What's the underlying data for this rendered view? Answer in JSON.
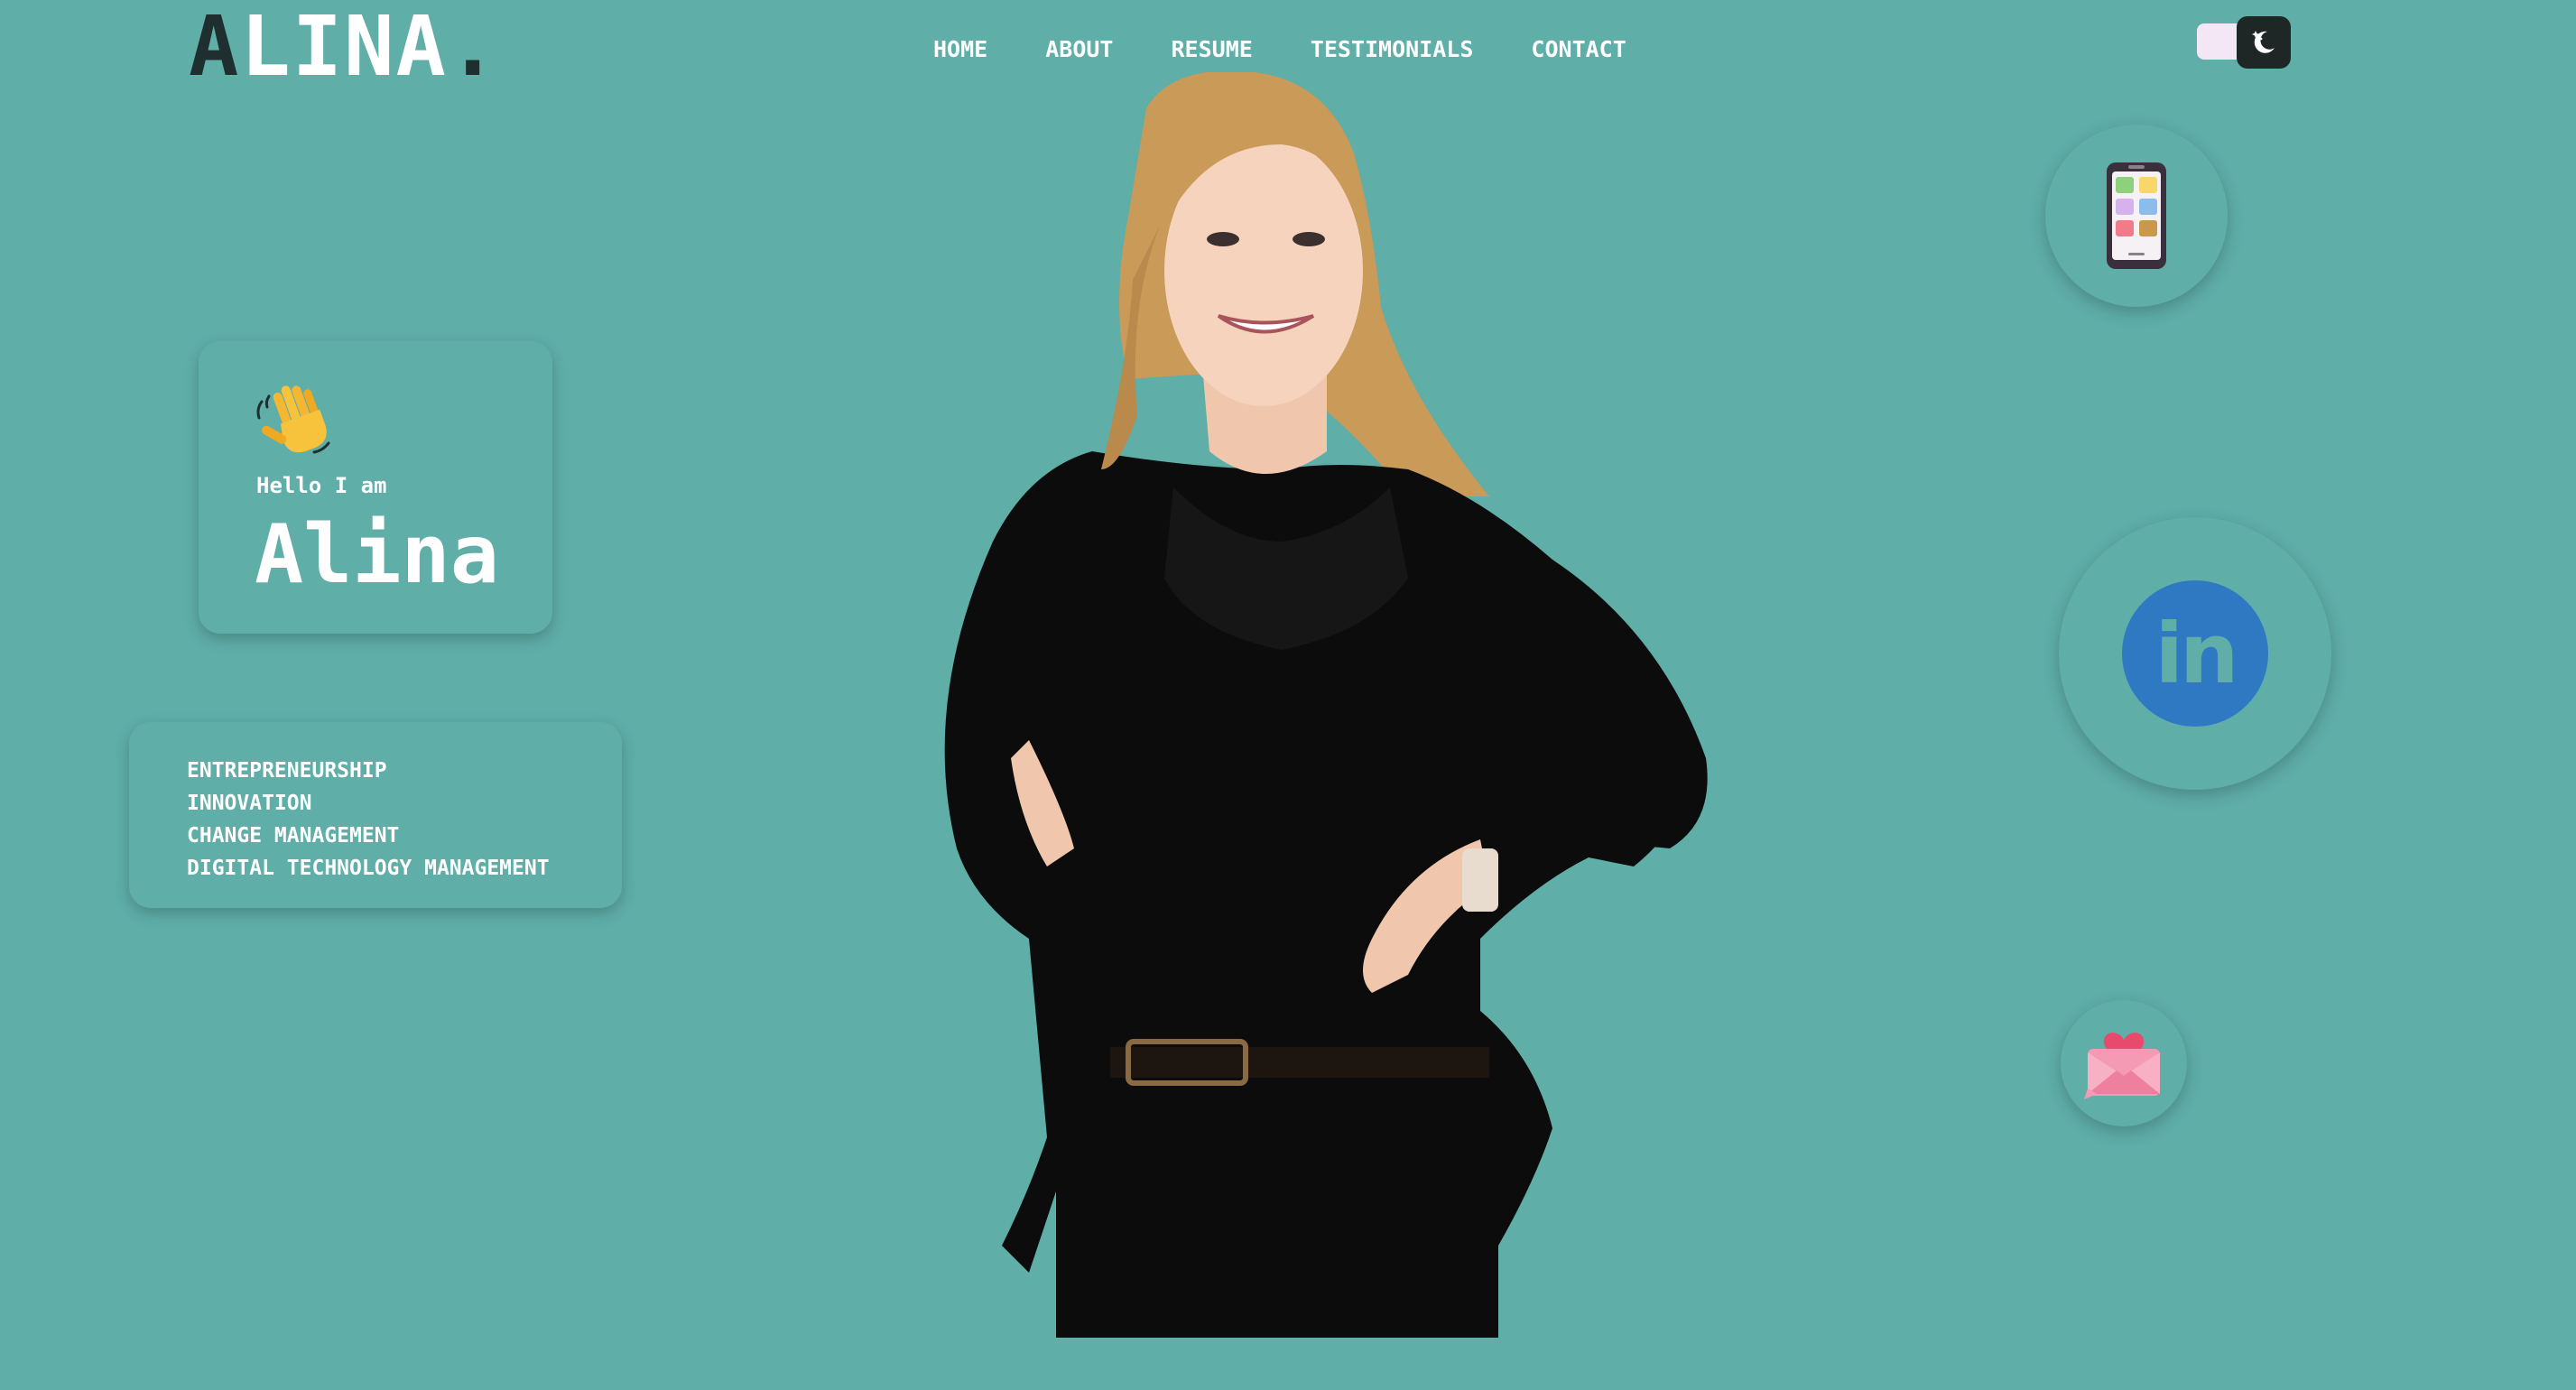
{
  "brand": {
    "first_letter": "A",
    "rest": "LINA",
    "dot": "."
  },
  "nav": {
    "home": "HOME",
    "about": "ABOUT",
    "resume": "RESUME",
    "testimonials": "TESTIMONIALS",
    "contact": "CONTACT"
  },
  "theme_toggle": {
    "mode": "dark",
    "icon": "moon-icon"
  },
  "hero": {
    "wave_icon": "waving-hand-icon",
    "greeting": "Hello I am",
    "name": "Alina"
  },
  "skills": [
    "ENTREPRENEURSHIP",
    "INNOVATION",
    "CHANGE MANAGEMENT",
    "DIGITAL TECHNOLOGY MANAGEMENT"
  ],
  "social": {
    "phone_icon": "phone-icon",
    "linkedin_label": "in",
    "mail_icon": "mail-icon"
  },
  "colors": {
    "background": "#5faea8",
    "linkedin_blue": "#2e79c2",
    "dark": "#1f2e2e"
  }
}
